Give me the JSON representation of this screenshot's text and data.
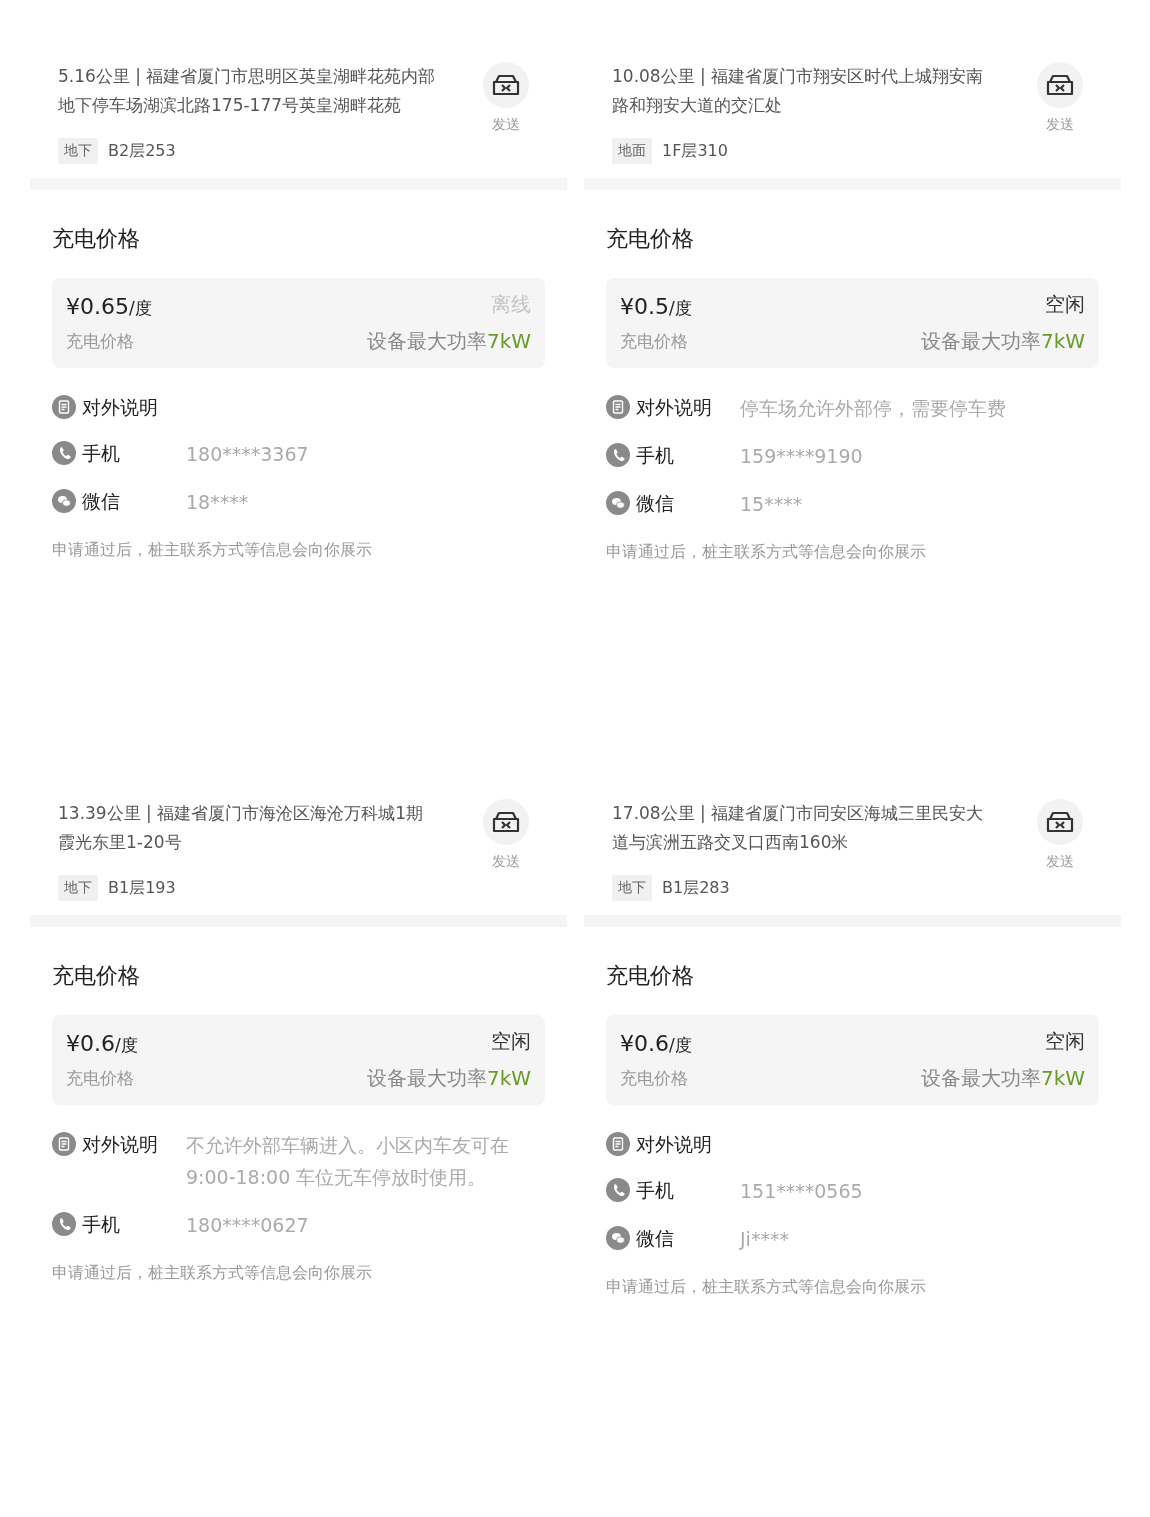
{
  "panels": [
    {
      "address": "5.16公里 | 福建省厦门市思明区英皇湖畔花苑内部地下停车场湖滨北路175-177号英皇湖畔花苑",
      "send_label": "发送",
      "floor_tag": "地下",
      "spot": "B2层253",
      "section_title": "充电价格",
      "price": "¥0.65",
      "unit": "/度",
      "price_label": "充电价格",
      "status": "离线",
      "offline": true,
      "power_label": "设备最大功率",
      "power_value": "7kW",
      "info": [
        {
          "kind": "note",
          "label": "对外说明"
        },
        {
          "kind": "phone",
          "label": "手机",
          "value": "180****3367"
        },
        {
          "kind": "wechat",
          "label": "微信",
          "value": "18****"
        }
      ],
      "footnote": "申请通过后，桩主联系方式等信息会向你展示"
    },
    {
      "address": "10.08公里 | 福建省厦门市翔安区时代上城翔安南路和翔安大道的交汇处",
      "send_label": "发送",
      "floor_tag": "地面",
      "spot": "1F层310",
      "section_title": "充电价格",
      "price": "¥0.5",
      "unit": "/度",
      "price_label": "充电价格",
      "status": "空闲",
      "offline": false,
      "power_label": "设备最大功率",
      "power_value": "7kW",
      "info": [
        {
          "kind": "note",
          "label": "对外说明",
          "value": "停车场允许外部停，需要停车费"
        },
        {
          "kind": "phone",
          "label": "手机",
          "value": "159****9190"
        },
        {
          "kind": "wechat",
          "label": "微信",
          "value": "15****"
        }
      ],
      "footnote": "申请通过后，桩主联系方式等信息会向你展示"
    },
    {
      "address": "13.39公里 | 福建省厦门市海沧区海沧万科城1期霞光东里1-20号",
      "send_label": "发送",
      "floor_tag": "地下",
      "spot": "B1层193",
      "section_title": "充电价格",
      "price": "¥0.6",
      "unit": "/度",
      "price_label": "充电价格",
      "status": "空闲",
      "offline": false,
      "power_label": "设备最大功率",
      "power_value": "7kW",
      "info": [
        {
          "kind": "note",
          "label": "对外说明",
          "value": "不允许外部车辆进入。小区内车友可在9:00-18:00 车位无车停放时使用。"
        },
        {
          "kind": "phone",
          "label": "手机",
          "value": "180****0627"
        }
      ],
      "footnote": "申请通过后，桩主联系方式等信息会向你展示"
    },
    {
      "address": "17.08公里 | 福建省厦门市同安区海城三里民安大道与滨洲五路交叉口西南160米",
      "send_label": "发送",
      "floor_tag": "地下",
      "spot": "B1层283",
      "section_title": "充电价格",
      "price": "¥0.6",
      "unit": "/度",
      "price_label": "充电价格",
      "status": "空闲",
      "offline": false,
      "power_label": "设备最大功率",
      "power_value": "7kW",
      "info": [
        {
          "kind": "note",
          "label": "对外说明"
        },
        {
          "kind": "phone",
          "label": "手机",
          "value": "151****0565"
        },
        {
          "kind": "wechat",
          "label": "微信",
          "value": "Ji****"
        }
      ],
      "footnote": "申请通过后，桩主联系方式等信息会向你展示"
    }
  ]
}
